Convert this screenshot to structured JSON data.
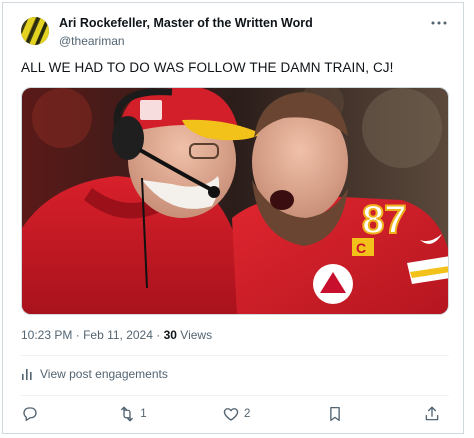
{
  "post": {
    "author": {
      "display_name": "Ari Rockefeller, Master of the Written Word",
      "handle": "@theariman",
      "avatar_icon": "striped-avatar-icon"
    },
    "text": "ALL WE HAD TO DO WAS FOLLOW THE DAMN TRAIN, CJ!",
    "media": {
      "kind": "photo",
      "jersey_number": "87"
    },
    "time": "10:23 PM",
    "separator": "·",
    "date": "Feb 11, 2024",
    "views_count": "30",
    "views_label": "Views"
  },
  "engagements": {
    "label": "View post engagements",
    "icon": "bar-chart-icon"
  },
  "actions": {
    "reply": {
      "icon": "reply-icon",
      "count": ""
    },
    "repost": {
      "icon": "repost-icon",
      "count": "1"
    },
    "like": {
      "icon": "heart-icon",
      "count": "2"
    },
    "bookmark": {
      "icon": "bookmark-icon",
      "count": ""
    },
    "share": {
      "icon": "share-icon",
      "count": ""
    }
  },
  "colors": {
    "text_primary": "#0f1419",
    "text_secondary": "#536471",
    "border": "#cfd9de",
    "chiefs_red": "#c8102e",
    "chiefs_gold": "#ffb81c"
  }
}
